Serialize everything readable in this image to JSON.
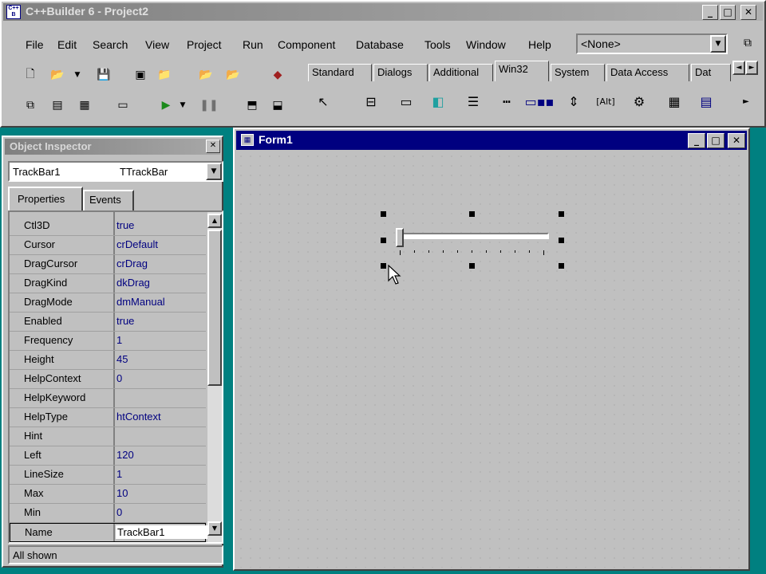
{
  "app": {
    "title": "C++Builder 6 - Project2",
    "icon": "cpp-builder-logo"
  },
  "menu": [
    "File",
    "Edit",
    "Search",
    "View",
    "Project",
    "Run",
    "Component",
    "Database",
    "Tools",
    "Window",
    "Help"
  ],
  "config_combo": {
    "value": "<None>"
  },
  "palette": {
    "tabs": [
      "Standard",
      "Dialogs",
      "Additional",
      "Win32",
      "System",
      "Data Access",
      "Dat"
    ],
    "active_tab": "Win32"
  },
  "object_inspector": {
    "title": "Object Inspector",
    "selector": {
      "name": "TrackBar1",
      "type": "TTrackBar"
    },
    "tabs": [
      "Properties",
      "Events"
    ],
    "properties": [
      {
        "name": "Ctl3D",
        "value": "true"
      },
      {
        "name": "Cursor",
        "value": "crDefault"
      },
      {
        "name": "DragCursor",
        "value": "crDrag"
      },
      {
        "name": "DragKind",
        "value": "dkDrag"
      },
      {
        "name": "DragMode",
        "value": "dmManual"
      },
      {
        "name": "Enabled",
        "value": "true"
      },
      {
        "name": "Frequency",
        "value": "1"
      },
      {
        "name": "Height",
        "value": "45"
      },
      {
        "name": "HelpContext",
        "value": "0"
      },
      {
        "name": "HelpKeyword",
        "value": ""
      },
      {
        "name": "HelpType",
        "value": "htContext"
      },
      {
        "name": "Hint",
        "value": ""
      },
      {
        "name": "Left",
        "value": "120"
      },
      {
        "name": "LineSize",
        "value": "1"
      },
      {
        "name": "Max",
        "value": "10"
      },
      {
        "name": "Min",
        "value": "0"
      },
      {
        "name": "Name",
        "value": "TrackBar1"
      }
    ],
    "status": "All shown"
  },
  "form": {
    "title": "Form1",
    "trackbar": {
      "position": 0,
      "max": 10,
      "ticks": 11
    }
  }
}
